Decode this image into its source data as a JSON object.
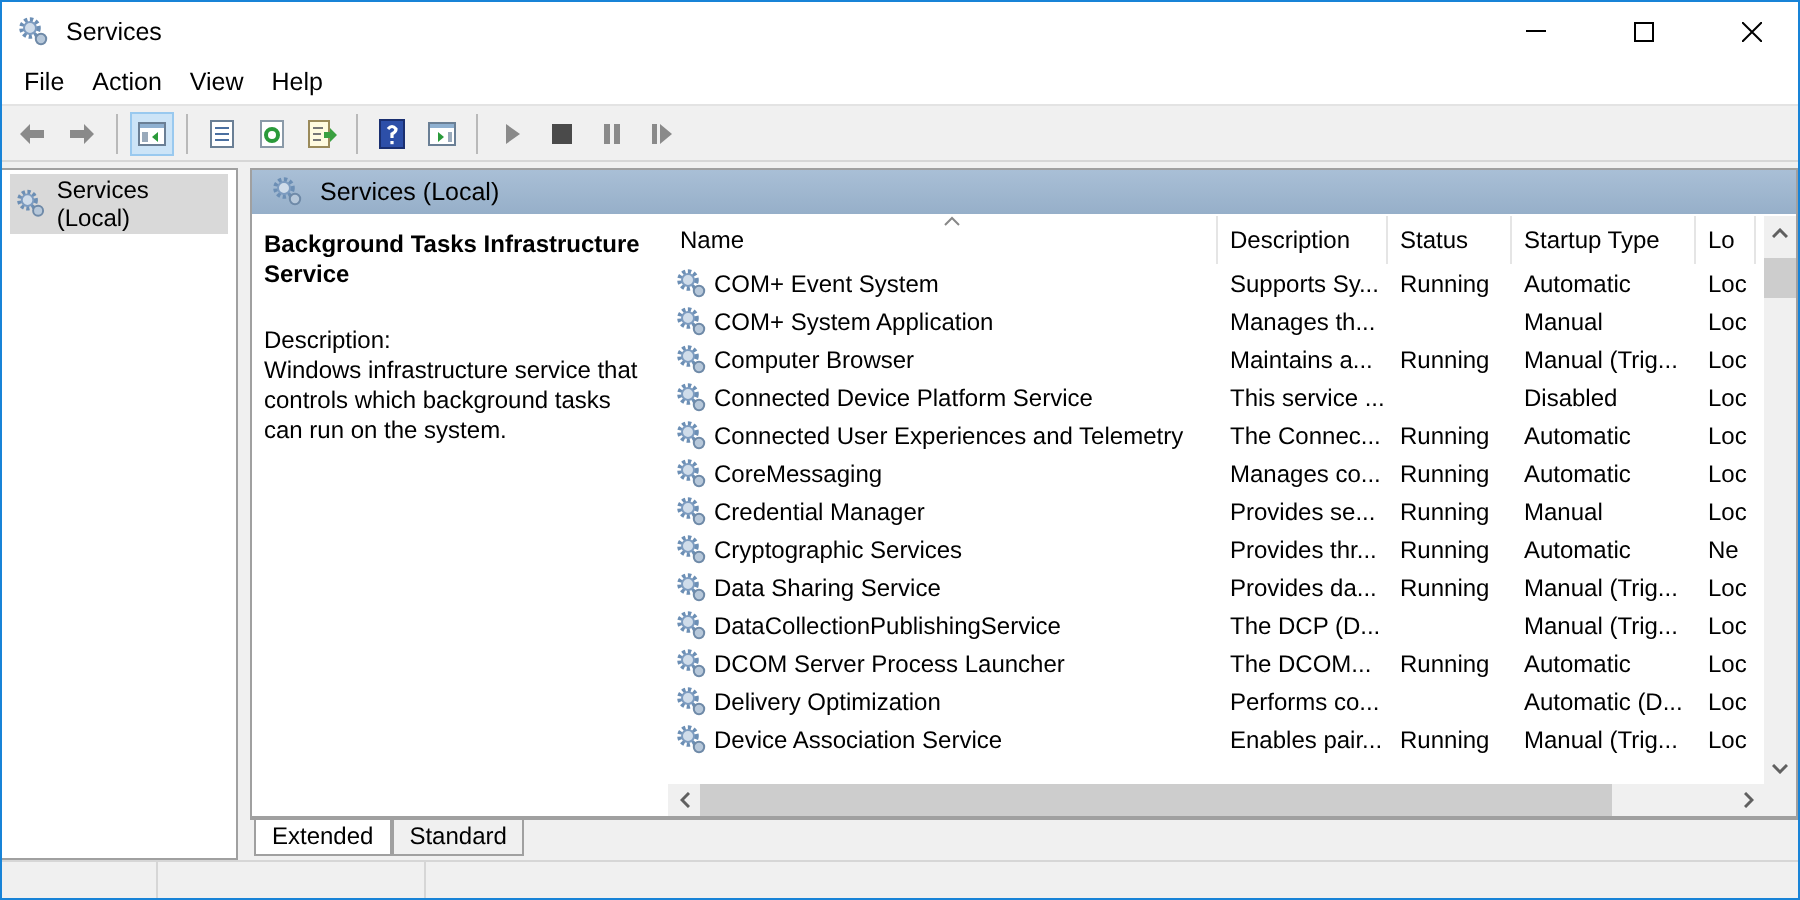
{
  "window": {
    "title": "Services"
  },
  "menu": [
    "File",
    "Action",
    "View",
    "Help"
  ],
  "toolbar": [
    {
      "kind": "back",
      "selected": false
    },
    {
      "kind": "forward",
      "selected": false
    },
    {
      "kind": "tree",
      "selected": true
    },
    {
      "kind": "properties",
      "selected": false
    },
    {
      "kind": "refresh",
      "selected": false
    },
    {
      "kind": "export",
      "selected": false
    },
    {
      "kind": "help",
      "selected": false
    },
    {
      "kind": "pane",
      "selected": false
    },
    {
      "kind": "play",
      "selected": false
    },
    {
      "kind": "stop",
      "selected": false
    },
    {
      "kind": "pause",
      "selected": false
    },
    {
      "kind": "resume",
      "selected": false
    }
  ],
  "tree": {
    "items": [
      {
        "label": "Services (Local)",
        "selected": true
      }
    ]
  },
  "panel": {
    "title": "Services (Local)"
  },
  "details": {
    "service_name": "Background Tasks Infrastructure Service",
    "description_label": "Description:",
    "description": "Windows infrastructure service that controls which background tasks can run on the system."
  },
  "table": {
    "columns": [
      "Name",
      "Description",
      "Status",
      "Startup Type",
      "Lo"
    ],
    "rows": [
      {
        "name": "COM+ Event System",
        "description": "Supports Sy...",
        "status": "Running",
        "startup_type": "Automatic",
        "column_5": "Loc"
      },
      {
        "name": "COM+ System Application",
        "description": "Manages th...",
        "startup_type": "Manual",
        "column_5": "Loc"
      },
      {
        "name": "Computer Browser",
        "description": "Maintains a...",
        "status": "Running",
        "startup_type": "Manual (Trig...",
        "column_5": "Loc"
      },
      {
        "name": "Connected Device Platform Service",
        "description": "This service ...",
        "startup_type": "Disabled",
        "column_5": "Loc"
      },
      {
        "name": "Connected User Experiences and Telemetry",
        "description": "The Connec...",
        "status": "Running",
        "startup_type": "Automatic",
        "column_5": "Loc"
      },
      {
        "name": "CoreMessaging",
        "description": "Manages co...",
        "status": "Running",
        "startup_type": "Automatic",
        "column_5": "Loc"
      },
      {
        "name": "Credential Manager",
        "description": "Provides se...",
        "status": "Running",
        "startup_type": "Manual",
        "column_5": "Loc"
      },
      {
        "name": "Cryptographic Services",
        "description": "Provides thr...",
        "status": "Running",
        "startup_type": "Automatic",
        "column_5": "Ne"
      },
      {
        "name": "Data Sharing Service",
        "description": "Provides da...",
        "status": "Running",
        "startup_type": "Manual (Trig...",
        "column_5": "Loc"
      },
      {
        "name": "DataCollectionPublishingService",
        "description": "The DCP (D...",
        "startup_type": "Manual (Trig...",
        "column_5": "Loc"
      },
      {
        "name": "DCOM Server Process Launcher",
        "description": "The DCOM...",
        "status": "Running",
        "startup_type": "Automatic",
        "column_5": "Loc"
      },
      {
        "name": "Delivery Optimization",
        "description": "Performs co...",
        "startup_type": "Automatic (D...",
        "column_5": "Loc"
      },
      {
        "name": "Device Association Service",
        "description": "Enables pair...",
        "status": "Running",
        "startup_type": "Manual (Trig...",
        "column_5": "Loc"
      }
    ]
  },
  "tabs": [
    {
      "label": "Extended",
      "selected": true
    },
    {
      "label": "Standard",
      "selected": false
    }
  ]
}
